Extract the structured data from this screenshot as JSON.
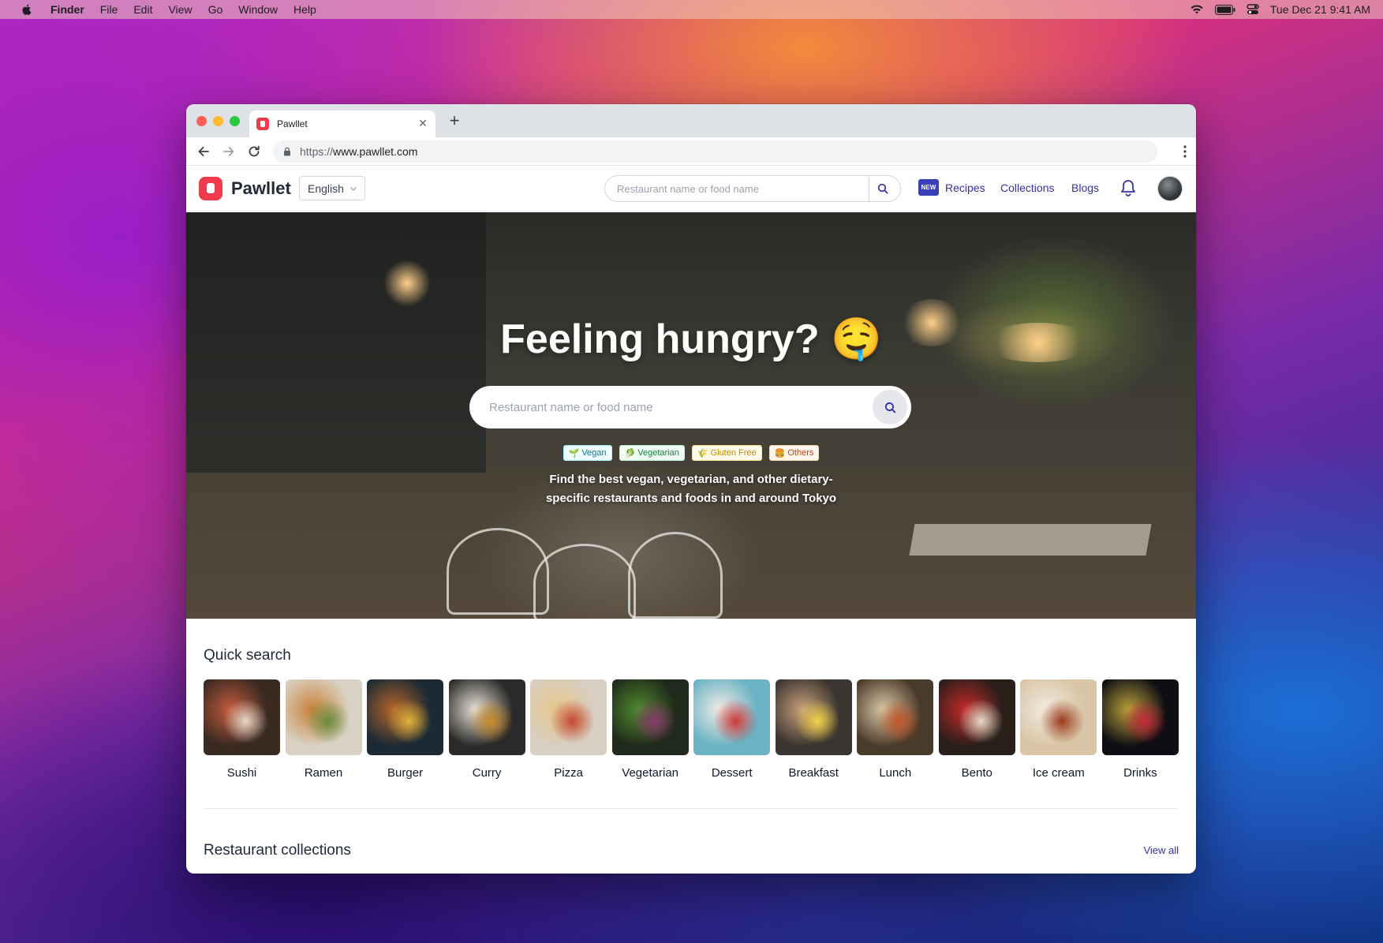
{
  "menubar": {
    "app": "Finder",
    "items": [
      "File",
      "Edit",
      "View",
      "Go",
      "Window",
      "Help"
    ],
    "clock": "Tue Dec 21  9:41 AM"
  },
  "browser": {
    "tab_title": "Pawllet",
    "url_scheme": "https://",
    "url_host": "www.pawllet.com"
  },
  "site": {
    "brand": "Pawllet",
    "language": "English",
    "header_search_placeholder": "Restaurant name or food name",
    "new_badge": "NEW",
    "nav": {
      "recipes": "Recipes",
      "collections": "Collections",
      "blogs": "Blogs"
    }
  },
  "hero": {
    "title": "Feeling hungry? 🤤",
    "search_placeholder": "Restaurant name or food name",
    "tags": [
      {
        "icon": "🌱",
        "label": "Vegan"
      },
      {
        "icon": "🥬",
        "label": "Vegetarian"
      },
      {
        "icon": "🌾",
        "label": "Gluten Free"
      },
      {
        "icon": "🍔",
        "label": "Others"
      }
    ],
    "subtitle": "Find the best vegan, vegetarian, and other dietary-specific restaurants and foods in and around Tokyo"
  },
  "quick_search": {
    "title": "Quick search",
    "items": [
      {
        "label": "Sushi",
        "colors": [
          "#3a2a22",
          "#c45a3c",
          "#e8d8c6"
        ]
      },
      {
        "label": "Ramen",
        "colors": [
          "#d9d2c4",
          "#c9823a",
          "#6b8a3a"
        ]
      },
      {
        "label": "Burger",
        "colors": [
          "#1b2a34",
          "#b5652a",
          "#e2b23a"
        ]
      },
      {
        "label": "Curry",
        "colors": [
          "#2a2a2a",
          "#e8e2d6",
          "#c98a2a"
        ]
      },
      {
        "label": "Pizza",
        "colors": [
          "#d8cfc2",
          "#e6c68a",
          "#c4472f"
        ]
      },
      {
        "label": "Vegetarian",
        "colors": [
          "#1f2a1a",
          "#4f8a2f",
          "#8a3a6a"
        ]
      },
      {
        "label": "Dessert",
        "colors": [
          "#6ab3c4",
          "#f2ece6",
          "#d23a3a"
        ]
      },
      {
        "label": "Breakfast",
        "colors": [
          "#3a3530",
          "#c9a07a",
          "#f2d34a"
        ]
      },
      {
        "label": "Lunch",
        "colors": [
          "#4a3a2a",
          "#d9c9a6",
          "#c4572a"
        ]
      },
      {
        "label": "Bento",
        "colors": [
          "#2a1e1a",
          "#c42a2a",
          "#e6dcc6"
        ]
      },
      {
        "label": "Ice cream",
        "colors": [
          "#d8c6a6",
          "#f2ebe0",
          "#9a3a1a"
        ]
      },
      {
        "label": "Drinks",
        "colors": [
          "#0e0e14",
          "#b8a13a",
          "#c42a3a"
        ]
      }
    ]
  },
  "collections": {
    "title": "Restaurant collections",
    "view_all": "View all"
  }
}
